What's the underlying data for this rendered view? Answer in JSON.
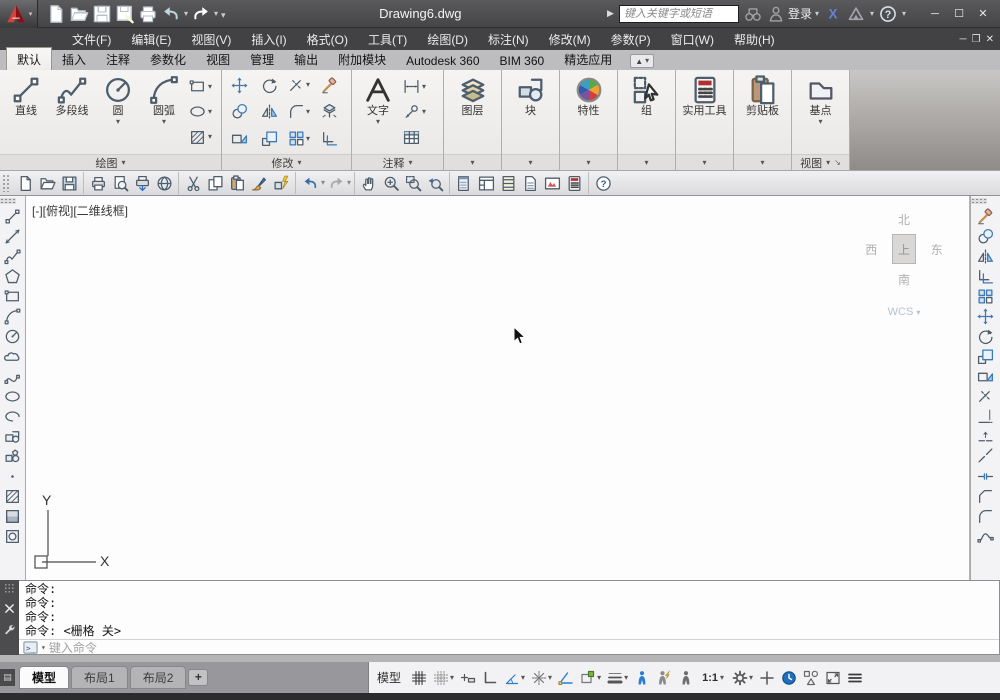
{
  "titlebar": {
    "title": "Drawing6.dwg",
    "qat_icons": [
      "new",
      "open",
      "save",
      "saveas",
      "plot"
    ],
    "search_placeholder": "键入关键字或短语",
    "signin_label": "登录"
  },
  "menubar": {
    "items": [
      "文件(F)",
      "编辑(E)",
      "视图(V)",
      "插入(I)",
      "格式(O)",
      "工具(T)",
      "绘图(D)",
      "标注(N)",
      "修改(M)",
      "参数(P)",
      "窗口(W)",
      "帮助(H)"
    ]
  },
  "ribbon": {
    "tabs": [
      "默认",
      "插入",
      "注释",
      "参数化",
      "视图",
      "管理",
      "输出",
      "附加模块",
      "Autodesk 360",
      "BIM 360",
      "精选应用"
    ],
    "active_tab": "默认",
    "draw_panel": {
      "label": "绘图",
      "buttons": [
        {
          "icon": "line",
          "label": "直线",
          "caret": false
        },
        {
          "icon": "polyline",
          "label": "多段线",
          "caret": false
        },
        {
          "icon": "circle",
          "label": "圆",
          "caret": true
        },
        {
          "icon": "arc",
          "label": "圆弧",
          "caret": true
        }
      ],
      "small_icons": [
        "rectangle",
        "ellipse",
        "hatch"
      ]
    },
    "modify_panel": {
      "label": "修改",
      "rows": [
        [
          {
            "icon": "move"
          },
          {
            "icon": "rotate"
          },
          {
            "icon": "trim",
            "caret": true
          },
          {
            "icon": "erase"
          }
        ],
        [
          {
            "icon": "copy-obj"
          },
          {
            "icon": "mirror"
          },
          {
            "icon": "fillet",
            "caret": true
          },
          {
            "icon": "explode"
          }
        ],
        [
          {
            "icon": "stretch"
          },
          {
            "icon": "scale"
          },
          {
            "icon": "array",
            "caret": true
          },
          {
            "icon": "offset"
          }
        ]
      ]
    },
    "annotate_panel": {
      "label": "注释",
      "text_button": {
        "icon": "text",
        "label": "文字"
      },
      "small_icons": [
        {
          "icon": "dimension",
          "caret": true
        },
        {
          "icon": "leader",
          "caret": true
        },
        {
          "icon": "table",
          "caret": false
        }
      ]
    },
    "big_panels": [
      {
        "icon": "layers",
        "label": "图层"
      },
      {
        "icon": "block",
        "label": "块"
      },
      {
        "icon": "propwheel",
        "label": "特性"
      },
      {
        "icon": "group",
        "label": "组"
      },
      {
        "icon": "calculator",
        "label": "实用工具"
      },
      {
        "icon": "clipboard",
        "label": "剪贴板"
      }
    ],
    "view_panel": {
      "label": "视图",
      "button": {
        "icon": "basepoint",
        "label": "基点"
      }
    }
  },
  "toolbar": {
    "groups": [
      [
        "new",
        "open",
        "save"
      ],
      [
        "plot",
        "preview",
        "publish",
        "dwf"
      ],
      [
        "cut",
        "copy",
        "paste",
        "matchprops",
        "blockedit"
      ],
      [
        "undo",
        "redo"
      ],
      [
        "pan",
        "zoomrt",
        "zoomwin",
        "zoomprev"
      ],
      [
        "properties",
        "designcenter",
        "toolpalettes",
        "sheetset",
        "markup",
        "quickcalc"
      ],
      [
        "help"
      ]
    ]
  },
  "canvas": {
    "viewport_label": "[-][俯视][二维线框]",
    "viewcube": {
      "north": "北",
      "west": "西",
      "east": "东",
      "south": "南",
      "top": "上",
      "wcs": "WCS"
    },
    "ucs": {
      "x": "X",
      "y": "Y"
    }
  },
  "left_toolbar": {
    "icons": [
      "line",
      "xline",
      "polyline",
      "polygon",
      "rectangle",
      "arc",
      "circle",
      "revcloud",
      "spline",
      "ellipse",
      "ellipsearc",
      "insertblock",
      "makeblock",
      "point",
      "hatch",
      "gradient",
      "region"
    ]
  },
  "right_toolbar": {
    "icons": [
      "erase",
      "copy-obj",
      "mirror",
      "offset",
      "array",
      "move",
      "rotate",
      "scale",
      "stretch",
      "trim",
      "extend",
      "breakpoint",
      "break",
      "join",
      "chamfer",
      "fillet",
      "blend"
    ]
  },
  "command": {
    "history": [
      "命令:",
      "命令:",
      "命令:",
      "命令:  <栅格 关>"
    ],
    "prompt_label": ">_",
    "input_placeholder": "键入命令"
  },
  "bottom": {
    "layout_tabs": [
      {
        "label": "模型",
        "active": true
      },
      {
        "label": "布局1",
        "active": false
      },
      {
        "label": "布局2",
        "active": false
      }
    ],
    "new_layout_label": "+",
    "model_toggle": "模型",
    "scale": "1:1",
    "status_left": [
      {
        "icon": "grid"
      },
      {
        "icon": "snap",
        "caret": true
      },
      {
        "icon": "dyninput"
      },
      {
        "icon": "ortho"
      },
      {
        "icon": "polar",
        "caret": true
      },
      {
        "icon": "otrack",
        "caret": true
      },
      {
        "icon": "osnap"
      },
      {
        "icon": "selcycle",
        "caret": true
      },
      {
        "icon": "lineweight",
        "caret": true
      },
      {
        "icon": "annvis"
      },
      {
        "icon": "autoscale"
      },
      {
        "icon": "annscale"
      }
    ],
    "status_right": [
      {
        "icon": "gear",
        "caret": true
      },
      {
        "icon": "annmonitor"
      },
      {
        "icon": "performance"
      },
      {
        "icon": "isolate"
      },
      {
        "icon": "cleanscreen"
      },
      {
        "icon": "customize"
      }
    ]
  }
}
